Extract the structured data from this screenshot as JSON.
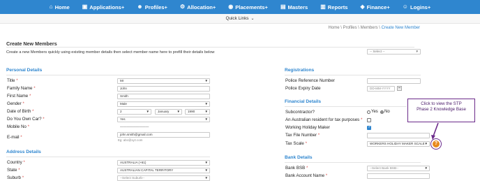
{
  "nav": [
    {
      "label": "Home",
      "icon": "home-icon",
      "glyph": "⌂"
    },
    {
      "label": "Applications+",
      "icon": "applications-icon",
      "glyph": "▣"
    },
    {
      "label": "Profiles+",
      "icon": "profiles-icon",
      "glyph": "☻"
    },
    {
      "label": "Allocation+",
      "icon": "allocation-icon",
      "glyph": "⚙"
    },
    {
      "label": "Placements+",
      "icon": "placements-icon",
      "glyph": "◉"
    },
    {
      "label": "Masters",
      "icon": "masters-icon",
      "glyph": "▤"
    },
    {
      "label": "Reports",
      "icon": "reports-icon",
      "glyph": "▥"
    },
    {
      "label": "Finance+",
      "icon": "finance-icon",
      "glyph": "◈"
    },
    {
      "label": "Logins+",
      "icon": "logins-icon",
      "glyph": "☺"
    }
  ],
  "quick_links": {
    "label": "Quick Links",
    "icon": "chevron-down-icon",
    "glyph": "⌄"
  },
  "breadcrumb": {
    "home": "Home",
    "sep1": " \\ ",
    "profiles": "Profiles",
    "sep2": " \\ ",
    "members": "Members",
    "sep3": " \\ ",
    "current": "Create New Member"
  },
  "page": {
    "title": "Create New Members",
    "intro": "Create a new Members quickly using existing member details then select member name here to prefill their details below",
    "prefill_placeholder": "-- Select --"
  },
  "personal": {
    "heading": "Personal Details",
    "title_label": "Title",
    "title_value": "Mr",
    "family_label": "Family Name",
    "family_value": "John",
    "first_label": "First Name",
    "first_value": "Smith",
    "gender_label": "Gender",
    "gender_value": "Male",
    "dob_label": "Date of Birth",
    "dob_day": "2",
    "dob_month": "January",
    "dob_year": "1990",
    "car_label": "Do You Own Car?",
    "car_value": "Yes",
    "mobile_label": "Mobile No",
    "mobile_value": "—————————",
    "email_label": "E-mail",
    "email_value": "john.smith@gmail.com",
    "email_hint": "Eg: abc@xyz.com"
  },
  "address": {
    "heading": "Address Details",
    "country_label": "Country",
    "country_value": "AUSTRALIA (+61)",
    "state_label": "State",
    "state_value": "AUSTRALIAN CAPITAL TERRITORY",
    "suburb_label": "Suburb",
    "suburb_value": "--Select Suburb--"
  },
  "registrations": {
    "heading": "Registrations",
    "police_ref_label": "Police Reference Number",
    "police_ref_value": "",
    "police_exp_label": "Police Expiry Date",
    "police_exp_placeholder": "DD-MM-YYYY"
  },
  "financial": {
    "heading": "Financial Details",
    "subcontractor_label": "Subcontractor?",
    "yes": "Yes",
    "no": "No",
    "resident_label": "An Australian resident for tax purposes",
    "holiday_label": "Working Holiday Maker",
    "tfn_label": "Tax File Number",
    "tfn_value": "",
    "scale_label": "Tax Scale",
    "scale_value": "WORKERS HOLIDAY MAKER SCALE"
  },
  "bank": {
    "heading": "Bank Details",
    "bsb_label": "Bank BSB",
    "bsb_value": "--Select Bank BSB--",
    "account_label": "Bank Account Name",
    "account_value": ""
  },
  "tooltip": {
    "line1": "Click to view the STP",
    "line2": "Phase 2 Knowledge Base"
  },
  "help_glyph": "?",
  "required_mark": "*",
  "colors": {
    "nav_bg": "#2f86cf",
    "accent": "#2f86cf",
    "required": "#d9534f",
    "callout": "#6b2a8a",
    "help": "#e8891c"
  }
}
